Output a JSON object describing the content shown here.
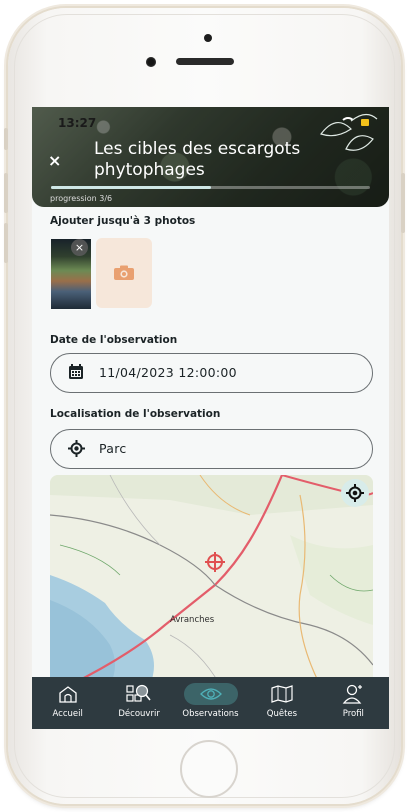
{
  "status_bar": {
    "time": "13:27"
  },
  "header": {
    "close_label": "×",
    "title": "Les cibles des escargots phytophages",
    "progress_label": "progression 3/6",
    "progress": 0.5
  },
  "photos": {
    "label": "Ajouter jusqu'à 3 photos",
    "remove_label": "×"
  },
  "date": {
    "label": "Date de l'observation",
    "value": "11/04/2023 12:00:00"
  },
  "location": {
    "label": "Localisation de l'observation",
    "value": "Parc"
  },
  "map": {
    "town_label": "Avranches"
  },
  "tabbar": {
    "items": [
      {
        "label": "Accueil",
        "icon": "home-icon"
      },
      {
        "label": "Découvrir",
        "icon": "discover-icon"
      },
      {
        "label": "Observations",
        "icon": "eye-icon",
        "active": true
      },
      {
        "label": "Quêtes",
        "icon": "map-icon"
      },
      {
        "label": "Profil",
        "icon": "profile-icon"
      }
    ]
  },
  "colors": {
    "header_overlay": "#2b3529",
    "accent_active": "#3c6468",
    "tabbar_bg": "#2e3a40",
    "add_photo_bg": "#f6e7da",
    "camera_icon": "#e9a070",
    "map_marker": "#e05050"
  }
}
